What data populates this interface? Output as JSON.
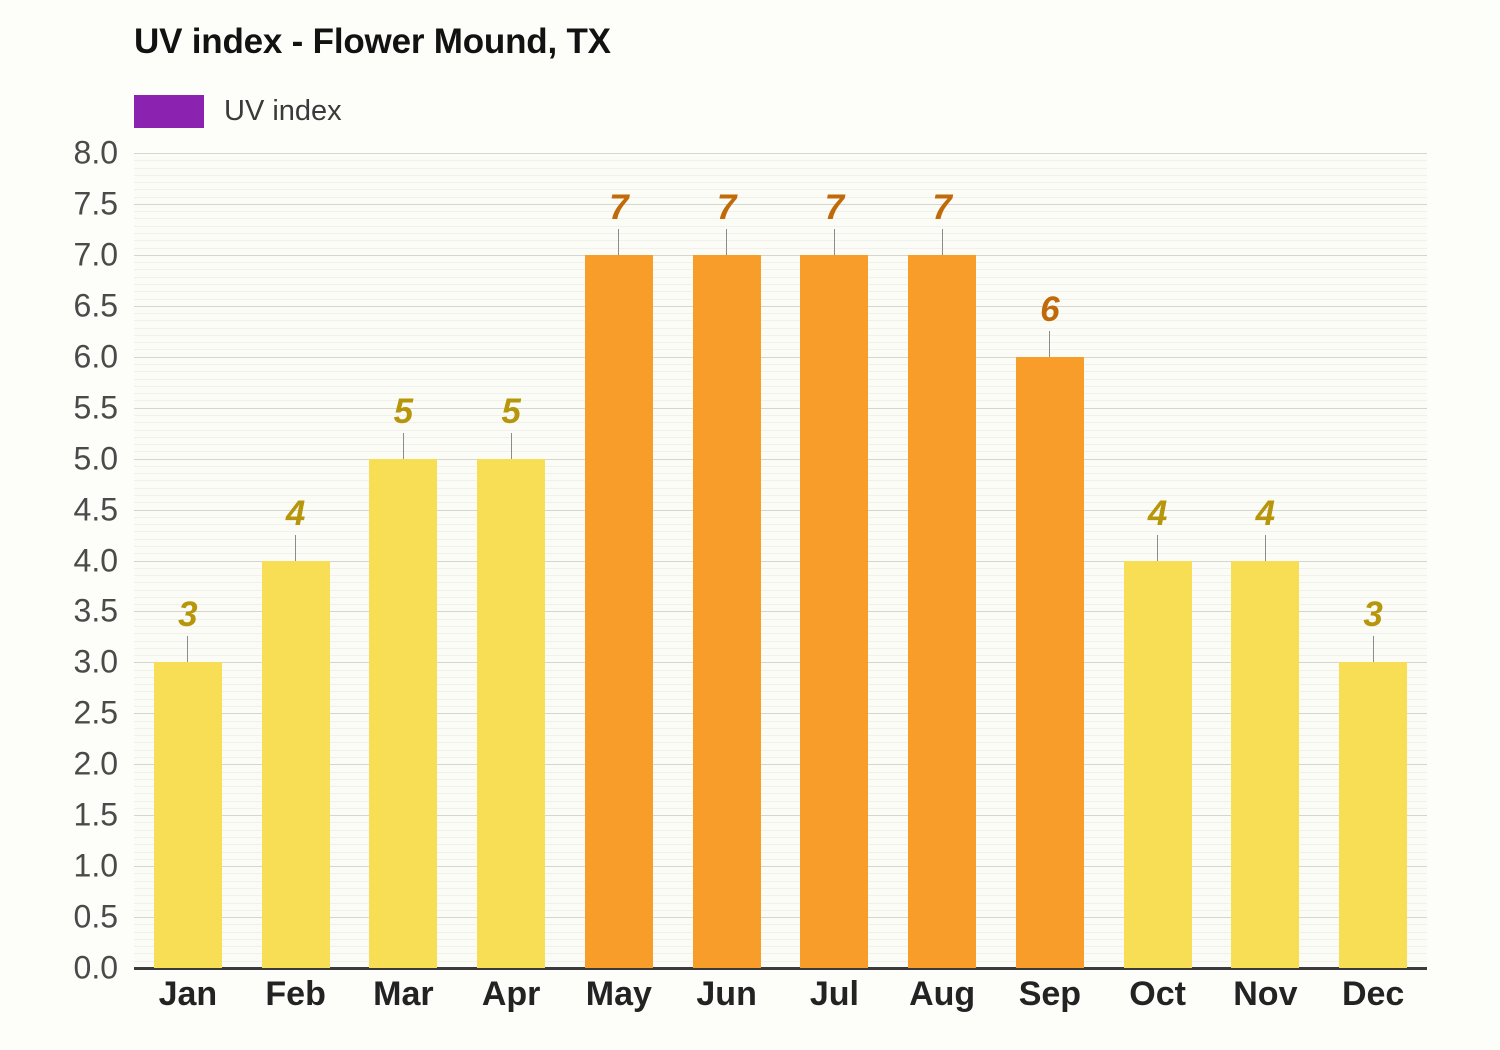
{
  "chart": {
    "title": "UV index - Flower Mound, TX",
    "legend": {
      "label": "UV index",
      "swatch_color": "#8C22B0"
    }
  },
  "colors": {
    "bar_low": "#F8DE54",
    "bar_high": "#F99D2A",
    "label_low": "#B8960C",
    "label_high": "#C06A0A",
    "gridline_major": "#d6d6d1",
    "gridline_minor": "#f0f1ec",
    "axis_line": "#3b3b3b",
    "plot_background": "#FBFCF6",
    "page_background": "#FDFEFA",
    "title_text": "#121212",
    "y_tick_text": "#4a4a4a",
    "x_tick_text": "#232323"
  },
  "chart_data": {
    "type": "bar",
    "title": "UV index - Flower Mound, TX",
    "xlabel": "",
    "ylabel": "",
    "ylim": [
      0.0,
      8.0
    ],
    "ytick_step": 0.5,
    "grid": true,
    "legend_position": "top-left",
    "categories": [
      "Jan",
      "Feb",
      "Mar",
      "Apr",
      "May",
      "Jun",
      "Jul",
      "Aug",
      "Sep",
      "Oct",
      "Nov",
      "Dec"
    ],
    "series": [
      {
        "name": "UV index",
        "values": [
          3,
          4,
          5,
          5,
          7,
          7,
          7,
          7,
          6,
          4,
          4,
          3
        ]
      }
    ],
    "point_labels": [
      "3",
      "4",
      "5",
      "5",
      "7",
      "7",
      "7",
      "7",
      "6",
      "4",
      "4",
      "3"
    ],
    "bar_colors": [
      "#F8DE54",
      "#F8DE54",
      "#F8DE54",
      "#F8DE54",
      "#F99D2A",
      "#F99D2A",
      "#F99D2A",
      "#F99D2A",
      "#F99D2A",
      "#F8DE54",
      "#F8DE54",
      "#F8DE54"
    ],
    "label_colors": [
      "#B8960C",
      "#B8960C",
      "#B8960C",
      "#B8960C",
      "#C06A0A",
      "#C06A0A",
      "#C06A0A",
      "#C06A0A",
      "#C06A0A",
      "#B8960C",
      "#B8960C",
      "#B8960C"
    ],
    "ytick_labels": [
      "0.0",
      "0.5",
      "1.0",
      "1.5",
      "2.0",
      "2.5",
      "3.0",
      "3.5",
      "4.0",
      "4.5",
      "5.0",
      "5.5",
      "6.0",
      "6.5",
      "7.0",
      "7.5",
      "8.0"
    ],
    "ytick_values": [
      0.0,
      0.5,
      1.0,
      1.5,
      2.0,
      2.5,
      3.0,
      3.5,
      4.0,
      4.5,
      5.0,
      5.5,
      6.0,
      6.5,
      7.0,
      7.5,
      8.0
    ]
  }
}
